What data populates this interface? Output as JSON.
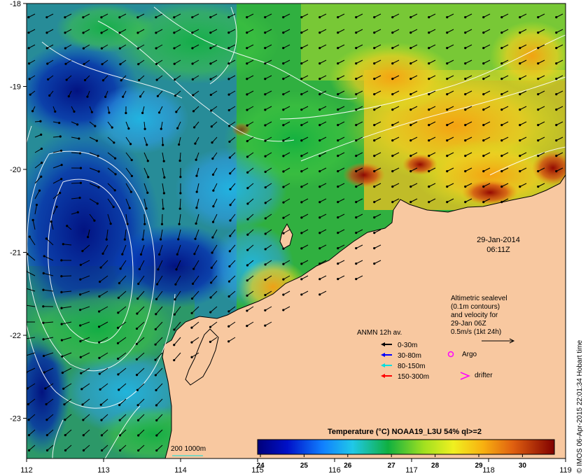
{
  "map": {
    "lon_ticks": [
      "112",
      "113",
      "114",
      "115",
      "116",
      "117",
      "118",
      "119"
    ],
    "lat_ticks": [
      "-18",
      "-19",
      "-20",
      "-21",
      "-22",
      "-23"
    ],
    "date": "29-Jan-2014",
    "time": "06:11Z",
    "altimetry_note": [
      "Altimetric sealevel",
      "(0.1m contours)",
      "and velocity for",
      "29-Jan 06Z",
      "0.5m/s (1kt 24h)"
    ],
    "legend": {
      "title": "ANMN 12h av.",
      "items": [
        {
          "label": "0-30m",
          "color": "#000000"
        },
        {
          "label": "30-80m",
          "color": "#0000ff"
        },
        {
          "label": "80-150m",
          "color": "#00e0e0"
        },
        {
          "label": "150-300m",
          "color": "#ff0000"
        }
      ],
      "argo": "Argo",
      "argo_color": "#ff00ff",
      "drifter": "drifter",
      "drifter_color": "#ff00ff"
    },
    "isobath_label": "200  1000m",
    "isobath_color": "#00e0e0",
    "colorbar": {
      "title": "Temperature (°C) NOAA19_L3U 54% ql>=2",
      "ticks": [
        "24",
        "25",
        "26",
        "27",
        "28",
        "29",
        "30"
      ]
    },
    "credit": "© IMOS 06-Apr-2015 22:01:34 Hobart time",
    "land_color": "#f8c8a0"
  }
}
